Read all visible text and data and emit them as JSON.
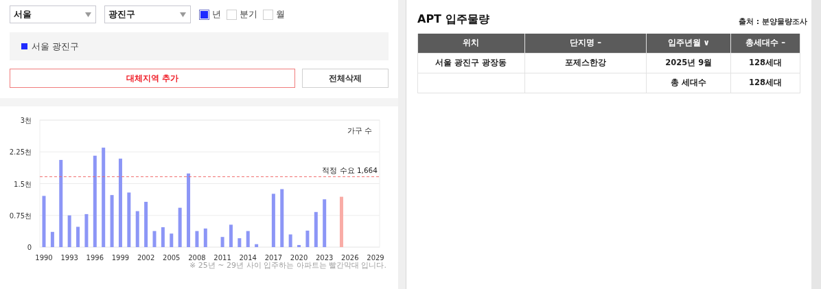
{
  "filters": {
    "region_select": {
      "value": "서울"
    },
    "district_select": {
      "value": "광진구"
    },
    "period_options": [
      {
        "label": "년",
        "checked": true
      },
      {
        "label": "분기",
        "checked": false
      },
      {
        "label": "월",
        "checked": false
      }
    ]
  },
  "selected_regions": [
    {
      "label": "서울 광진구",
      "color": "#1f2bff"
    }
  ],
  "buttons": {
    "add": "대체지역 추가",
    "clear": "전체삭제"
  },
  "chart": {
    "chart_data": {
      "type": "bar",
      "ylabel": "가구 수",
      "categories": [
        "1990",
        null,
        null,
        "1993",
        null,
        null,
        "1996",
        null,
        null,
        "1999",
        null,
        null,
        "2002",
        null,
        null,
        "2005",
        null,
        null,
        "2008",
        null,
        null,
        "2011",
        null,
        null,
        "2014",
        null,
        null,
        "2017",
        null,
        null,
        "2020",
        null,
        null,
        "2023",
        null,
        null,
        "2026",
        null,
        null,
        "2029"
      ],
      "series": [
        {
          "color": "#8c96f6",
          "values": [
            1.21,
            0.36,
            2.06,
            0.75,
            0.48,
            0.78,
            2.16,
            2.35,
            1.23,
            2.09,
            1.29,
            0.85,
            1.07,
            0.38,
            0.47,
            0.32,
            0.93,
            1.74,
            0.38,
            0.44,
            null,
            0.24,
            0.53,
            0.21,
            0.38,
            0.07,
            null,
            1.26,
            1.37,
            0.3,
            0.05,
            0.39,
            0.83,
            1.13,
            null,
            null,
            null,
            null,
            null,
            null
          ]
        },
        {
          "color": "#f9aca6",
          "values": [
            null,
            null,
            null,
            null,
            null,
            null,
            null,
            null,
            null,
            null,
            null,
            null,
            null,
            null,
            null,
            null,
            null,
            null,
            null,
            null,
            null,
            null,
            null,
            null,
            null,
            null,
            null,
            null,
            null,
            null,
            null,
            null,
            null,
            null,
            null,
            1.19,
            null,
            null,
            null,
            null
          ]
        }
      ],
      "ylim": [
        0,
        3
      ],
      "yticks": [
        {
          "value": 0,
          "label": "0"
        },
        {
          "value": 0.75,
          "label": "0.75천"
        },
        {
          "value": 1.5,
          "label": "1.5천"
        },
        {
          "value": 2.25,
          "label": "2.25천"
        },
        {
          "value": 3,
          "label": "3천"
        }
      ],
      "grid": true,
      "ref_lines": [
        {
          "axis": "y",
          "value": 1.664,
          "label": "적정 수요 1,664"
        }
      ]
    },
    "footnote": "※ 25년 ~ 29년 사이 입주하는 아파트는 빨간막대 입니다."
  },
  "supply_panel": {
    "title": "APT 입주물량",
    "source": "출처 : 분양물량조사",
    "table": {
      "columns": [
        "위치",
        "단지명 –",
        "입주년월 ∨",
        "총세대수 –"
      ],
      "rows": [
        [
          "서울 광진구 광장동",
          "포제스한강",
          "2025년 9월",
          "128세대"
        ],
        [
          "",
          "",
          "총 세대수",
          "128세대"
        ]
      ]
    }
  }
}
